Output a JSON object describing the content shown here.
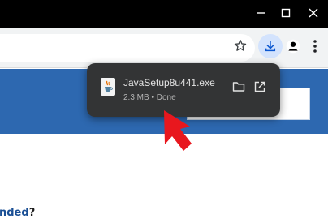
{
  "window_controls": {
    "minimize_icon": "minimize-icon",
    "maximize_icon": "maximize-icon",
    "close_icon": "close-icon"
  },
  "toolbar": {
    "bookmark_icon": "star-icon",
    "downloads_icon": "download-icon",
    "profile_icon": "profile-icon",
    "menu_icon": "kebab-menu-icon",
    "downloads_active_color": "#d3e3fd"
  },
  "download_bubble": {
    "file_name": "JavaSetup8u441.exe",
    "status": "2.3 MB • Done",
    "file_icon": "java-file-icon",
    "show_in_folder_icon": "folder-icon",
    "open_external_icon": "open-external-icon"
  },
  "page": {
    "banner_color": "#2d68b0",
    "text_fragment": "nded",
    "text_suffix": "?"
  },
  "annotation": {
    "pointer_icon": "red-arrow-icon",
    "color": "#e8171e"
  }
}
